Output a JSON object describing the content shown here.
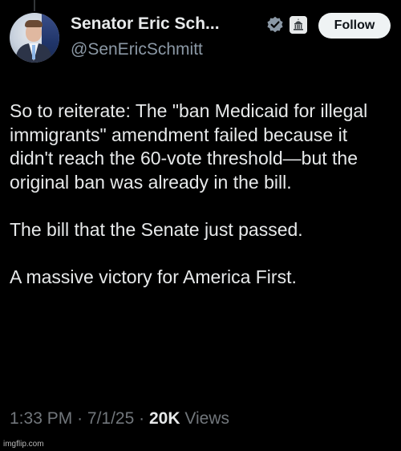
{
  "author": {
    "display_name": "Senator Eric Sch...",
    "handle": "@SenEricSchmitt",
    "verified_icon": "verified-badge-icon",
    "affiliation_icon": "government-building-icon"
  },
  "follow_button": {
    "label": "Follow"
  },
  "tweet": {
    "paragraphs": [
      "So to reiterate: The \"ban Medicaid for illegal immigrants\" amendment failed because it didn't reach the 60-vote threshold—but the original ban was already in the bill.",
      "The bill that the Senate just passed.",
      "A massive victory for America First."
    ],
    "time": "1:33 PM",
    "separator": "·",
    "date": "7/1/25",
    "views_count": "20K",
    "views_label": "Views"
  },
  "watermark": "imgflip.com",
  "colors": {
    "background": "#000000",
    "primary_text": "#e7e9ea",
    "secondary_text": "#71767b",
    "verified_blue": "#1d9bf0",
    "button_bg": "#eff3f4"
  }
}
